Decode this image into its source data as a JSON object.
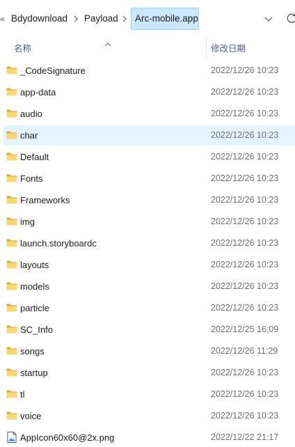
{
  "breadcrumb": {
    "overflow": "«",
    "items": [
      "Bdydownload",
      "Payload"
    ],
    "current": "Arc-mobile.app"
  },
  "icons": {
    "overflow": "chevron-double-left-icon",
    "separator": "chevron-right-icon",
    "dropdown": "chevron-down-icon",
    "refresh": "refresh-icon",
    "sort": "sort-up-icon",
    "folder": "folder-icon",
    "image_file": "image-file-icon"
  },
  "columns": {
    "name": "名称",
    "date_modified": "修改日期"
  },
  "colors": {
    "folder": "#f8d775",
    "selected_row": "#e5f3ff",
    "crumb_highlight": "#cce8ff"
  },
  "files": [
    {
      "name": "_CodeSignature",
      "date": "2022/12/26 10:23",
      "type": "folder"
    },
    {
      "name": "app-data",
      "date": "2022/12/26 10:23",
      "type": "folder"
    },
    {
      "name": "audio",
      "date": "2022/12/26 10:23",
      "type": "folder"
    },
    {
      "name": "char",
      "date": "2022/12/26 10:23",
      "type": "folder",
      "selected": true
    },
    {
      "name": "Default",
      "date": "2022/12/26 10:23",
      "type": "folder"
    },
    {
      "name": "Fonts",
      "date": "2022/12/26 10:23",
      "type": "folder"
    },
    {
      "name": "Frameworks",
      "date": "2022/12/26 10:23",
      "type": "folder"
    },
    {
      "name": "img",
      "date": "2022/12/26 10:23",
      "type": "folder"
    },
    {
      "name": "launch.storyboardc",
      "date": "2022/12/26 10:23",
      "type": "folder"
    },
    {
      "name": "layouts",
      "date": "2022/12/26 10:23",
      "type": "folder"
    },
    {
      "name": "models",
      "date": "2022/12/26 10:23",
      "type": "folder"
    },
    {
      "name": "particle",
      "date": "2022/12/26 10:23",
      "type": "folder"
    },
    {
      "name": "SC_Info",
      "date": "2022/12/25 16:09",
      "type": "folder"
    },
    {
      "name": "songs",
      "date": "2022/12/26 11:29",
      "type": "folder"
    },
    {
      "name": "startup",
      "date": "2022/12/26 10:23",
      "type": "folder"
    },
    {
      "name": "tl",
      "date": "2022/12/26 10:23",
      "type": "folder"
    },
    {
      "name": "voice",
      "date": "2022/12/26 10:23",
      "type": "folder"
    },
    {
      "name": "AppIcon60x60@2x.png",
      "date": "2022/12/22 21:17",
      "type": "image"
    }
  ]
}
